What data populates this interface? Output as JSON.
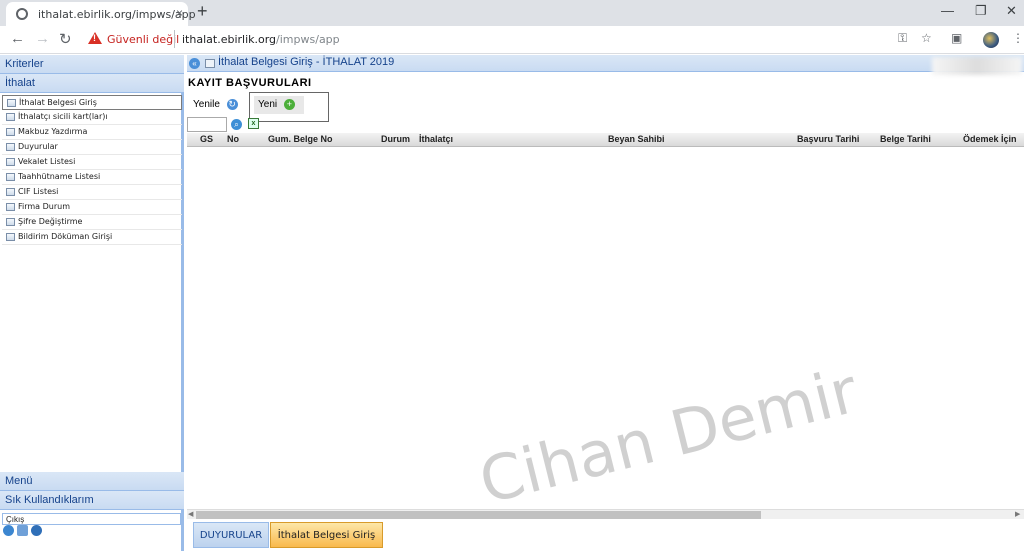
{
  "browser": {
    "tab_title": "ithalat.ebirlik.org/impws/app",
    "new_tab": "+",
    "close": "×",
    "security_warning": "Güvenli değil",
    "url_host": "ithalat.ebirlik.org",
    "url_path": "/impws/app"
  },
  "sidebar": {
    "criteria_label": "Kriterler",
    "section_label": "İthalat",
    "items": [
      {
        "label": "İthalat Belgesi Giriş"
      },
      {
        "label": "İthalatçı sicili kart(lar)ı"
      },
      {
        "label": "Makbuz Yazdırma"
      },
      {
        "label": "Duyurular"
      },
      {
        "label": "Vekalet Listesi"
      },
      {
        "label": "Taahhütname Listesi"
      },
      {
        "label": "CIF Listesi"
      },
      {
        "label": "Firma Durum"
      },
      {
        "label": "Şifre Değiştirme"
      },
      {
        "label": "Bildirim Döküman Girişi"
      }
    ],
    "menu_label": "Menü",
    "favorites_label": "Sık Kullandıklarım",
    "logout_label": "Çıkış"
  },
  "panel": {
    "title": "İthalat Belgesi Giriş - İTHALAT 2019",
    "section_title": "KAYIT BAŞVURULARI",
    "refresh_label": "Yenile",
    "new_label": "Yeni"
  },
  "grid": {
    "columns": [
      "GS",
      "No",
      "Gum. Belge No",
      "Durum",
      "İthalatçı",
      "Beyan Sahibi",
      "Başvuru Tarihi",
      "Belge Tarihi",
      "Ödemek İçin"
    ],
    "rows": []
  },
  "bottom_tabs": {
    "tab1": "DUYURULAR",
    "tab2": "İthalat Belgesi Giriş"
  },
  "watermark": "Cihan Demir",
  "colors": {
    "header_blue": "#15428b",
    "active_tab": "#f9b94d",
    "warning_red": "#c5221f"
  }
}
